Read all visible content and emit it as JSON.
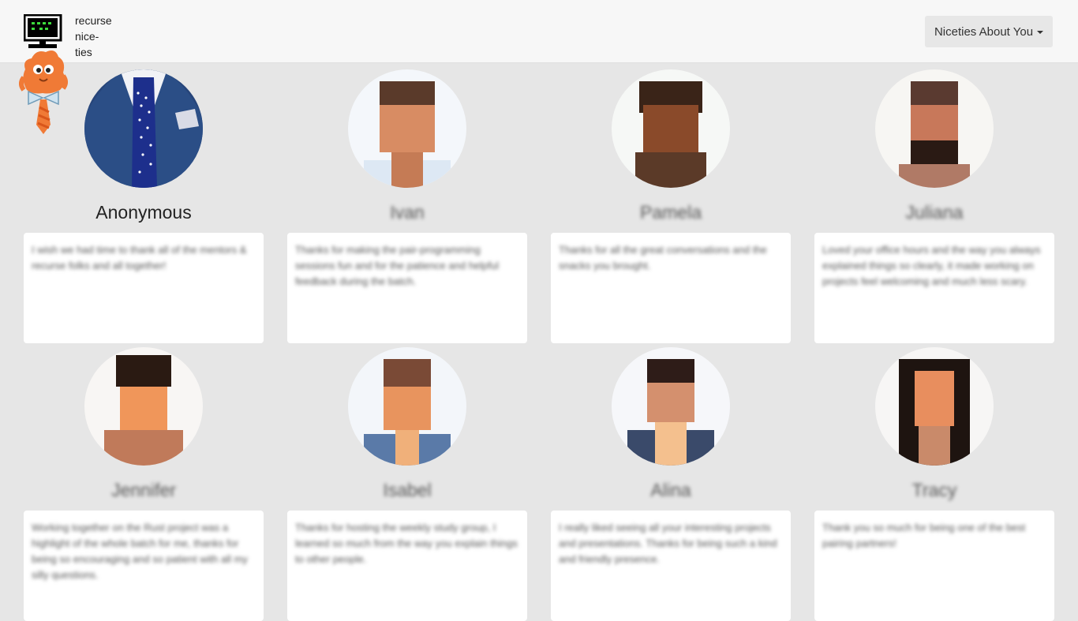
{
  "brand": {
    "lines": [
      "recurse",
      "nice-",
      "ties"
    ]
  },
  "menu": {
    "label": "Niceties About You"
  },
  "cards": [
    {
      "name": "Anonymous",
      "text": "I wish we had time to thank all of the mentors & recurse folks and all together!"
    },
    {
      "name": "Ivan",
      "text": "Thanks for making the pair-programming sessions fun and for the patience and helpful feedback during the batch."
    },
    {
      "name": "Pamela",
      "text": "Thanks for all the great conversations and the snacks you brought."
    },
    {
      "name": "Juliana",
      "text": "Loved your office hours and the way you always explained things so clearly, it made working on projects feel welcoming and much less scary."
    },
    {
      "name": "Jennifer",
      "text": "Working together on the Rust project was a highlight of the whole batch for me, thanks for being so encouraging and so patient with all my silly questions."
    },
    {
      "name": "Isabel",
      "text": "Thanks for hosting the weekly study group, I learned so much from the way you explain things to other people."
    },
    {
      "name": "Alina",
      "text": "I really liked seeing all your interesting projects and presentations. Thanks for being such a kind and friendly presence."
    },
    {
      "name": "Tracy",
      "text": "Thank you so much for being one of the best pairing partners!"
    }
  ]
}
